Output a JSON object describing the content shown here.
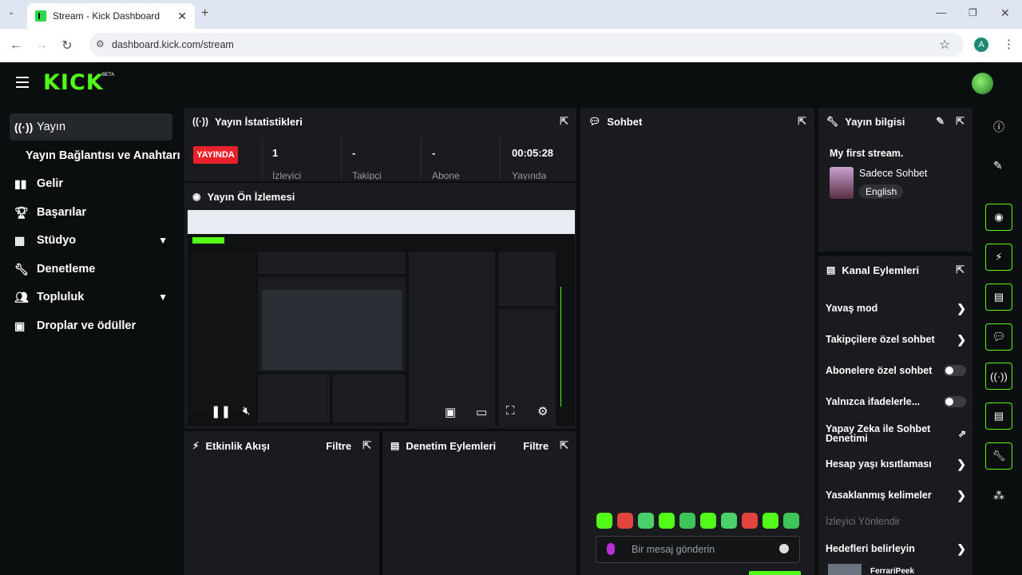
{
  "browser": {
    "tab_title": "Stream - Kick Dashboard",
    "url": "dashboard.kick.com/stream",
    "profile_letter": "A"
  },
  "header": {
    "logo": "KICK",
    "beta": "BETA"
  },
  "sidebar": {
    "items": [
      {
        "label": "Yayın",
        "icon": "broadcast-icon"
      },
      {
        "label": "Yayın Bağlantısı ve Anahtarı",
        "icon": ""
      },
      {
        "label": "Gelir",
        "icon": "chart-icon"
      },
      {
        "label": "Başarılar",
        "icon": "trophy-icon"
      },
      {
        "label": "Stüdyo",
        "icon": "grid-icon"
      },
      {
        "label": "Denetleme",
        "icon": "wrench-icon"
      },
      {
        "label": "Topluluk",
        "icon": "people-icon"
      },
      {
        "label": "Droplar ve ödüller",
        "icon": "gift-icon"
      }
    ]
  },
  "stats": {
    "title": "Yayın İstatistikleri",
    "live_badge": "YAYINDA",
    "viewers_value": "1",
    "viewers_label": "İzleyici",
    "followers_value": "-",
    "followers_label": "Takipçi",
    "subs_value": "-",
    "subs_label": "Abone",
    "uptime_value": "00:05:28",
    "uptime_label": "Yayında"
  },
  "preview": {
    "title": "Yayın Ön İzlemesi"
  },
  "activity": {
    "title": "Etkinlik Akışı",
    "filter": "Filtre"
  },
  "moderation": {
    "title": "Denetim Eylemleri",
    "filter": "Filtre"
  },
  "chat": {
    "title": "Sohbet",
    "placeholder": "Bir mesaj gönderin"
  },
  "stream_info": {
    "title": "Yayın bilgisi",
    "stream_title": "My first stream.",
    "category": "Sadece Sohbet",
    "language": "English"
  },
  "channel_actions": {
    "title": "Kanal Eylemleri",
    "items": [
      {
        "label": "Yavaş mod",
        "control": "chevron"
      },
      {
        "label": "Takipçilere özel sohbet",
        "control": "chevron"
      },
      {
        "label": "Abonelere özel sohbet",
        "control": "toggle"
      },
      {
        "label": "Yalnızca ifadelerle...",
        "control": "toggle"
      },
      {
        "label": "Yapay Zeka ile Sohbet Denetimi",
        "control": "external"
      },
      {
        "label": "Hesap yaşı kısıtlaması",
        "control": "chevron"
      },
      {
        "label": "Yasaklanmış kelimeler",
        "control": "chevron"
      },
      {
        "label": "İzleyici Yönlendir",
        "control": "none"
      },
      {
        "label": "Hedefleri belirleyin",
        "control": "chevron"
      }
    ],
    "bottom_user": "FerrariPeek"
  },
  "colors": {
    "accent": "#53fc18",
    "live": "#e8212b",
    "panel": "#191b1f",
    "bg": "#0b0e0f"
  }
}
